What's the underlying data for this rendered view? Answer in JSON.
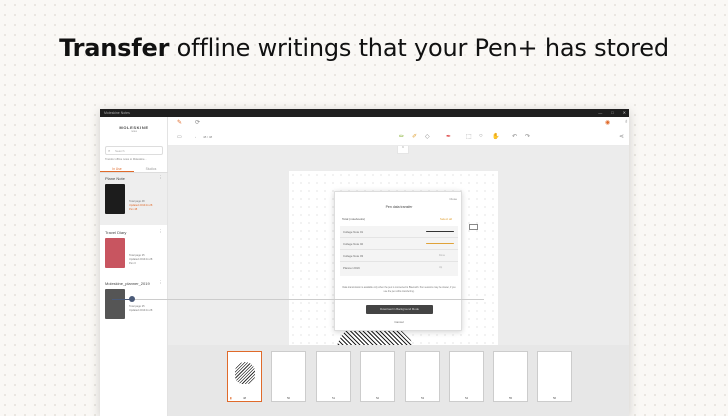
{
  "headline": {
    "bold": "Transfer",
    "rest": " offline writings that your Pen+ has stored"
  },
  "window": {
    "title": "Moleskine Notes",
    "controls": [
      "—",
      "□",
      "✕"
    ]
  },
  "sidebar": {
    "brand": "MOLESKINE",
    "brand_sub": "notes",
    "search_placeholder": "Search",
    "sync_link": "Transfer offline notes to Moleskine...",
    "tabs": [
      "In Use",
      "Studios"
    ],
    "notebooks": [
      {
        "title": "Plane Note",
        "color": "#1c1c1c",
        "info": [
          "Total page 48",
          "Updated 2019.11.28",
          "Pen 48"
        ]
      },
      {
        "title": "Travel Diary",
        "color": "#c85560",
        "info": [
          "Total page 25",
          "Updated 2019.11.28",
          "Pen 0"
        ]
      },
      {
        "title": "Moleskine_planner_2019",
        "color": "#555555",
        "info": [
          "Total page 25",
          "Updated 2019.11.28"
        ]
      }
    ]
  },
  "toolbar": {
    "page_indicator": "48 / 48",
    "icons": [
      "pen-icon",
      "sync-icon",
      "pencil-icon",
      "marker-icon",
      "eraser-icon",
      "select-icon",
      "lasso-icon",
      "hand-icon",
      "undo-icon",
      "redo-icon",
      "share-icon",
      "copy-icon",
      "text-icon",
      "tag-icon",
      "delete-icon"
    ]
  },
  "modal": {
    "close": "Close",
    "title": "Pen data transfer",
    "total_label": "Total (notebooks)",
    "select_all": "Select all",
    "rows": [
      {
        "label": "College Note 01",
        "status": ""
      },
      {
        "label": "College Note 02",
        "status": ""
      },
      {
        "label": "College Note 03",
        "status": "Done"
      },
      {
        "label": "Planner 2019",
        "status": "Up"
      }
    ],
    "note": "Data transmission is available only when the pen is connected to Bluetooth. Pen sessions may be slower, if you use the pen while transferring.",
    "primary_button": "Download in Background Mode",
    "cancel": "Cancel"
  },
  "pages": [
    "48",
    "50",
    "51",
    "52",
    "53",
    "54",
    "55",
    "56"
  ],
  "colors": {
    "accent": "#e06a2a",
    "progress": "#e0a33a",
    "slider": "#4a5a78"
  }
}
